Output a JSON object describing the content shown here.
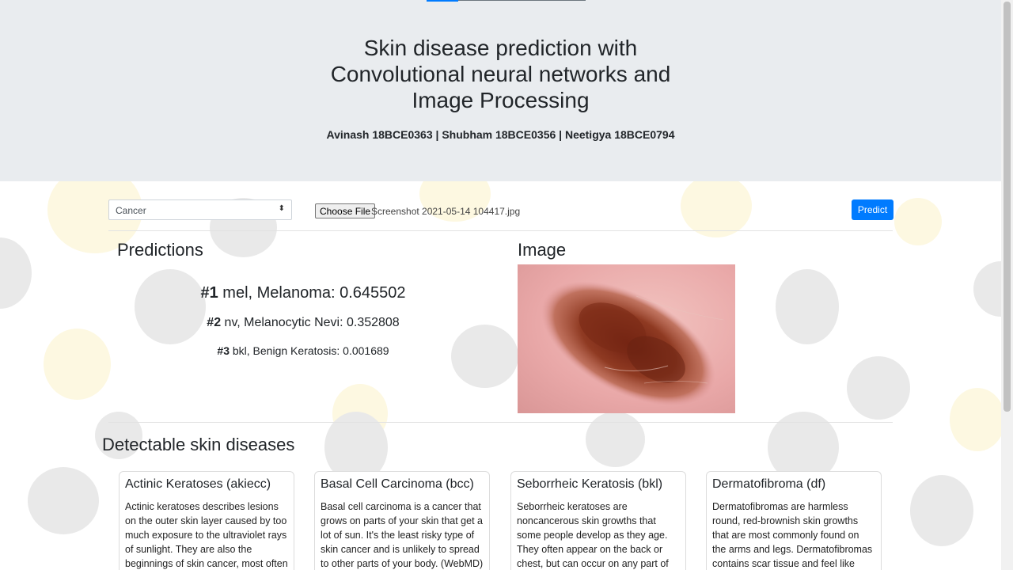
{
  "header": {
    "title_lines": [
      "Skin disease prediction with",
      "Convolutional neural networks and",
      "Image Processing"
    ],
    "authors": "Avinash 18BCE0363 | Shubham 18BCE0356 | Neetigya 18BCE0794"
  },
  "controls": {
    "select_value": "Cancer",
    "choose_file_label": "Choose File",
    "file_name": "Screenshot 2021-05-14 104417.jpg",
    "predict_label": "Predict"
  },
  "predictions": {
    "heading": "Predictions",
    "items": [
      {
        "rank": "#1",
        "text": "mel, Melanoma: 0.645502"
      },
      {
        "rank": "#2",
        "text": "nv, Melanocytic Nevi: 0.352808"
      },
      {
        "rank": "#3",
        "text": "bkl, Benign Keratosis: 0.001689"
      }
    ]
  },
  "image_section": {
    "heading": "Image"
  },
  "diseases": {
    "heading": "Detectable skin diseases",
    "cards": [
      {
        "title": "Actinic Keratoses (akiecc)",
        "text": "Actinic keratoses describes lesions on the outer skin layer caused by too much exposure to the ultraviolet rays of sunlight. They are also the beginnings of skin cancer, most often"
      },
      {
        "title": "Basal Cell Carcinoma (bcc)",
        "text": "Basal cell carcinoma is a cancer that grows on parts of your skin that get a lot of sun. It's the least risky type of skin cancer and is unlikely to spread to other parts of your body. (WebMD)"
      },
      {
        "title": "Seborrheic Keratosis (bkl)",
        "text": "Seborrheic keratoses are noncancerous skin growths that some people develop as they age. They often appear on the back or chest, but can occur on any part of"
      },
      {
        "title": "Dermatofibroma (df)",
        "text": "Dermatofibromas are harmless round, red-brownish skin growths that are most commonly found on the arms and legs. Dermatofibromas contains scar tissue and feel like hard lumps in"
      }
    ]
  },
  "colors": {
    "header_bg": "#e9ecef",
    "primary_button": "#007bff"
  },
  "icons": {
    "select_arrow": "updown-arrows-icon"
  }
}
